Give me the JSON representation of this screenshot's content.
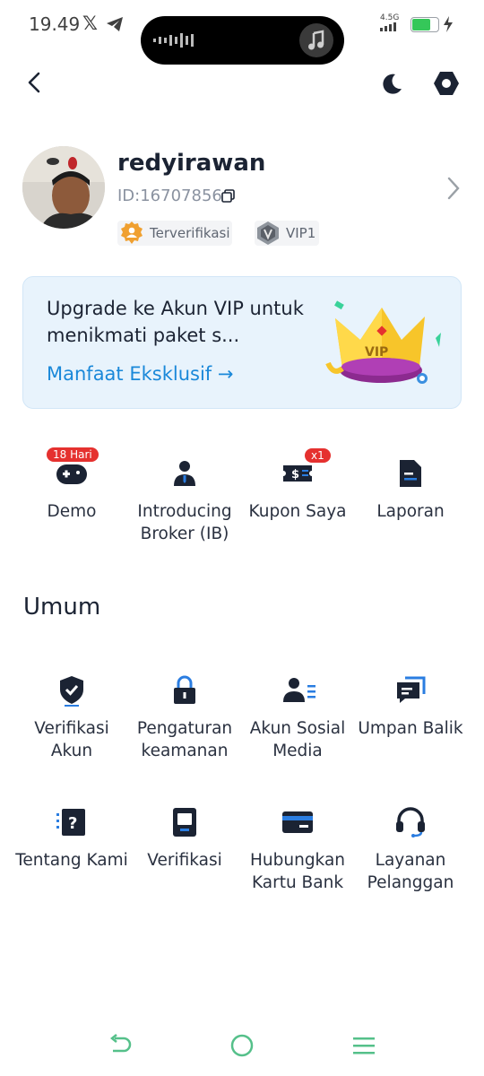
{
  "status_bar": {
    "time": "19.49",
    "network": "4.5G"
  },
  "header": {
    "back_icon": "chevron-left-icon",
    "theme_icon": "moon-icon",
    "settings_icon": "hexagon-settings-icon"
  },
  "profile": {
    "username": "redyirawan",
    "user_id": "ID:16707856",
    "verified_label": "Terverifikasi",
    "vip_label": "VIP1"
  },
  "vip_card": {
    "title": "Upgrade ke Akun VIP untuk menikmati paket s...",
    "link": "Manfaat Eksklusif →",
    "crown_text": "VIP"
  },
  "quick_actions": [
    {
      "label": "Demo",
      "badge": "18 Hari",
      "icon": "gamepad-icon"
    },
    {
      "label": "Introducing Broker (IB)",
      "icon": "broker-icon"
    },
    {
      "label": "Kupon Saya",
      "badge": "x1",
      "icon": "coupon-icon"
    },
    {
      "label": "Laporan",
      "icon": "document-icon"
    }
  ],
  "general": {
    "title": "Umum",
    "items": [
      {
        "label": "Verifikasi Akun",
        "icon": "shield-check-icon"
      },
      {
        "label": "Pengaturan keamanan",
        "icon": "lock-icon"
      },
      {
        "label": "Akun Sosial Media",
        "icon": "user-list-icon"
      },
      {
        "label": "Umpan Balik",
        "icon": "feedback-icon"
      },
      {
        "label": "Tentang Kami",
        "icon": "about-icon"
      },
      {
        "label": "Verifikasi",
        "icon": "id-card-icon"
      },
      {
        "label": "Hubungkan Kartu Bank",
        "icon": "bank-card-icon"
      },
      {
        "label": "Layanan Pelanggan",
        "icon": "headset-icon"
      }
    ]
  },
  "colors": {
    "accent": "#1a88d9",
    "icon_dark": "#1b2333",
    "badge_red": "#e5312f",
    "verified_orange": "#f0a030"
  }
}
